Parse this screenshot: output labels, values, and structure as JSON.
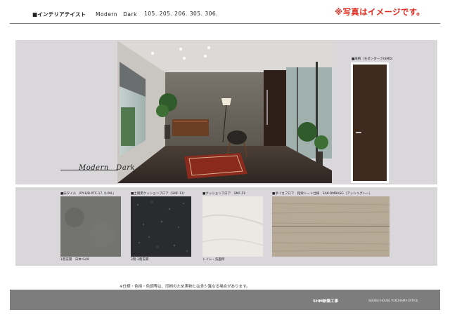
{
  "header": {
    "title": "■インテリアテイスト",
    "style_name": "Modern　Dark",
    "units": "105. 205. 206. 305. 306.",
    "note": "※写真はイメージです。"
  },
  "photo": {
    "caption": "Modern　Dark"
  },
  "door": {
    "label": "■扉柄（モダンダーク(SMD)",
    "color": "#3f2a20"
  },
  "swatches": [
    {
      "label": "■床タイル　IPY-6/B-PTC-17（LIXIL）",
      "caption": "1階玄関　日本:G49",
      "color": "#6b6b68"
    },
    {
      "label": "■土間用クッションフロア（SMF-11）",
      "caption": "2階-3階玄関",
      "color": "#2a2b2c"
    },
    {
      "label": "■クッションフロア　SMF-51",
      "caption": "トイレ・洗面所",
      "color": "#ece9e4"
    },
    {
      "label": "■ダイカフロア　銘栄シート仕様　SAK-DMBASG（アッシュグレー）",
      "caption": "",
      "color": "#b6a995"
    }
  ],
  "footer": {
    "note": "※仕様・色柄・色調等は、印刷のため実物とは多少異なる場合があります。",
    "center": "SHM新築工事",
    "right": "SEKISUI HOUSE YOKOHAMA OFFICE"
  }
}
